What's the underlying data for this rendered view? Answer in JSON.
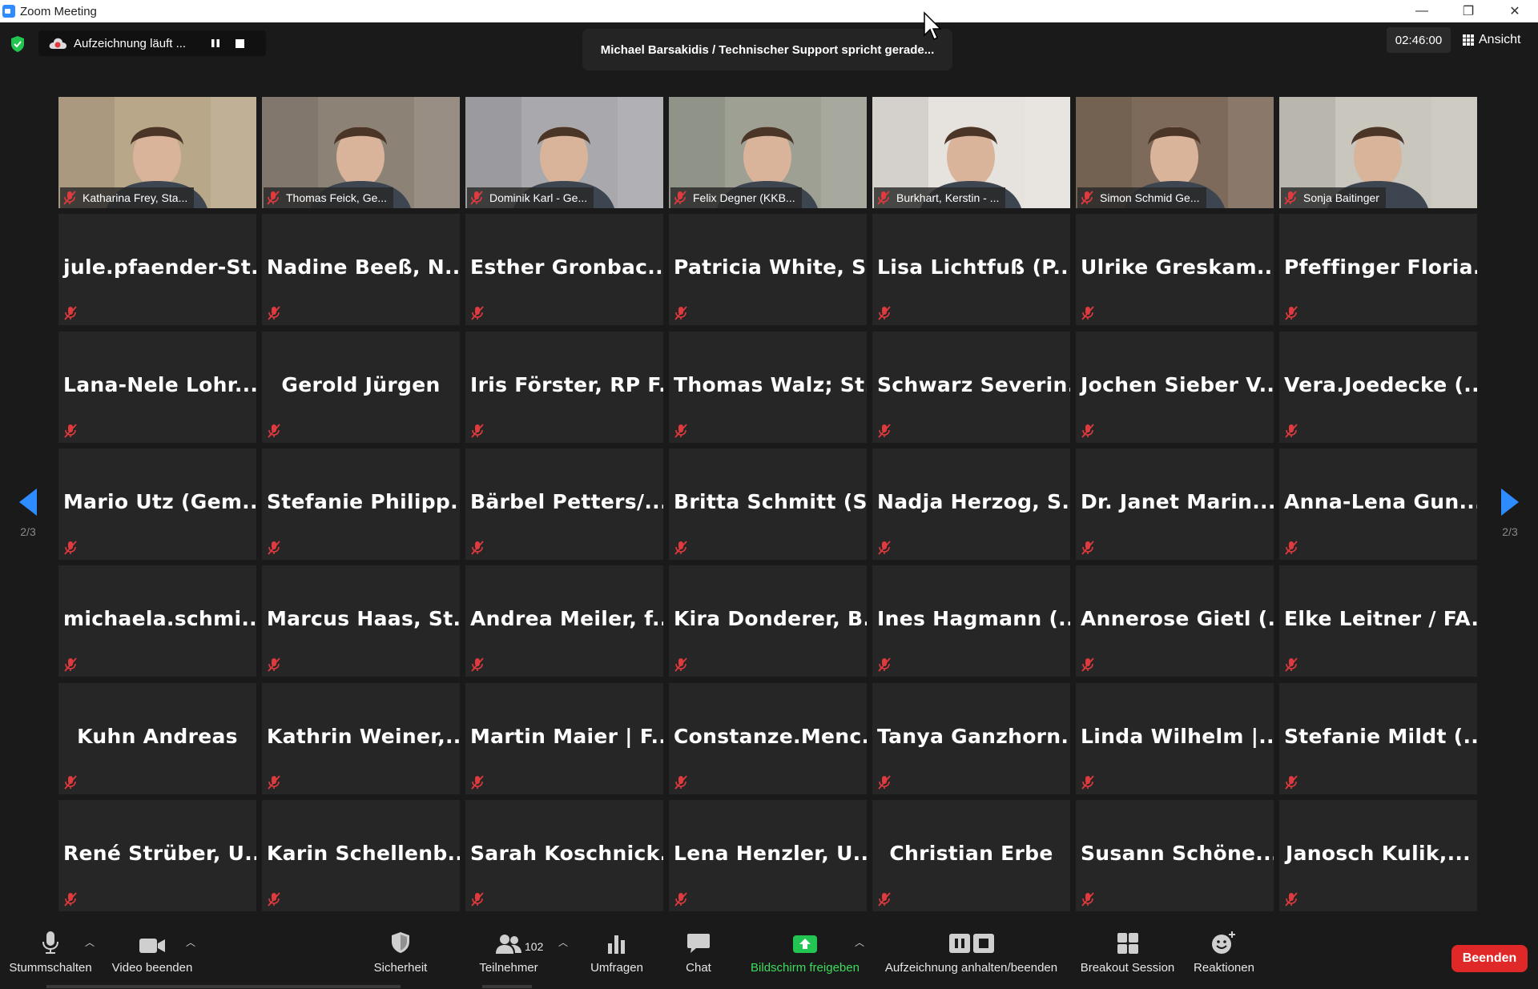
{
  "window": {
    "title": "Zoom Meeting",
    "controls": [
      "—",
      "❐",
      "✕"
    ]
  },
  "topbar": {
    "recording_label": "Aufzeichnung läuft ...",
    "speaker_banner": "Michael Barsakidis / Technischer Support spricht gerade...",
    "timer": "02:46:00",
    "view_label": "Ansicht"
  },
  "video_tiles": [
    {
      "name": "Katharina Frey, Sta...",
      "bg": "#b9a789"
    },
    {
      "name": "Thomas Feick, Ge...",
      "bg": "#8d8276"
    },
    {
      "name": "Dominik Karl - Ge...",
      "bg": "#a9a9ad"
    },
    {
      "name": "Felix Degner (KKB...",
      "bg": "#9da093"
    },
    {
      "name": "Burkhart, Kerstin - ...",
      "bg": "#e6e2dd"
    },
    {
      "name": "Simon Schmid Ge...",
      "bg": "#7d6a5a"
    },
    {
      "name": "Sonja Baitinger",
      "bg": "#c9c6bd"
    }
  ],
  "name_tiles": [
    [
      "jule.pfaender-St...",
      "Nadine Beeß, N...",
      "Esther Gronbac...",
      "Patricia White, S...",
      "Lisa Lichtfuß (P...",
      "Ulrike Greskam...",
      "Pfeffinger Floria..."
    ],
    [
      "Lana-Nele Lohr...",
      "Gerold Jürgen",
      "Iris Förster, RP F...",
      "Thomas Walz; St...",
      "Schwarz Severin...",
      "Jochen Sieber V...",
      "Vera.Joedecke (..."
    ],
    [
      "Mario Utz (Gem...",
      "Stefanie Philipp...",
      "Bärbel Petters/...",
      "Britta Schmitt (S...",
      "Nadja Herzog, S...",
      "Dr. Janet Marin...",
      "Anna-Lena Gun..."
    ],
    [
      "michaela.schmi...",
      "Marcus Haas, St...",
      "Andrea Meiler, f...",
      "Kira Donderer, B...",
      "Ines Hagmann (...",
      "Annerose Gietl (...",
      "Elke Leitner / FA..."
    ],
    [
      "Kuhn Andreas",
      "Kathrin Weiner,...",
      "Martin Maier | F...",
      "Constanze.Menc...",
      "Tanya Ganzhorn...",
      "Linda Wilhelm |...",
      "Stefanie Mildt (..."
    ],
    [
      "René Strüber, U...",
      "Karin Schellenb...",
      "Sarah Koschnick...",
      "Lena Henzler, U...",
      "Christian Erbe",
      "Susann Schöne...",
      "Janosch Kulik,..."
    ]
  ],
  "pager": {
    "left_label": "2/3",
    "right_label": "2/3"
  },
  "toolbar": {
    "mute": "Stummschalten",
    "video": "Video beenden",
    "security": "Sicherheit",
    "participants": "Teilnehmer",
    "participant_count": "102",
    "polls": "Umfragen",
    "chat": "Chat",
    "share": "Bildschirm freigeben",
    "recording": "Aufzeichnung anhalten/beenden",
    "breakout": "Breakout Session",
    "reactions": "Reaktionen",
    "end": "Beenden"
  },
  "colors": {
    "accent": "#2d8cff",
    "share_green": "#3ddc5c",
    "end_red": "#e02828",
    "muted_red": "#e0393e"
  }
}
